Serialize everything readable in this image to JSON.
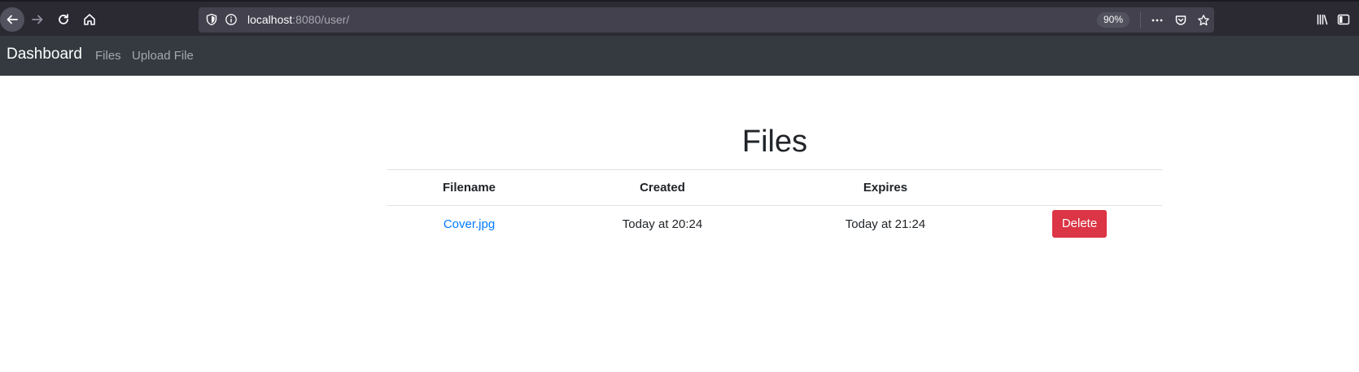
{
  "browser": {
    "url_host": "localhost",
    "url_rest": ":8080/user/",
    "zoom": "90%"
  },
  "navbar": {
    "brand": "Dashboard",
    "links": [
      {
        "label": "Files"
      },
      {
        "label": "Upload File"
      }
    ],
    "background_color": "#343a40"
  },
  "main": {
    "title": "Files",
    "table": {
      "headers": [
        "Filename",
        "Created",
        "Expires",
        ""
      ],
      "rows": [
        {
          "filename": "Cover.jpg",
          "created": "Today at 20:24",
          "expires": "Today at 21:24",
          "action_label": "Delete"
        }
      ]
    }
  },
  "colors": {
    "link": "#007bff",
    "danger": "#dc3545",
    "browser_chrome": "#2b2a33"
  },
  "icons": {
    "back": "back-arrow-icon",
    "forward": "forward-arrow-icon",
    "reload": "reload-icon",
    "home": "home-icon",
    "tracking": "shield-icon",
    "site_info": "info-icon",
    "page_actions": "more-icon",
    "pocket": "pocket-icon",
    "bookmark": "star-icon",
    "library": "library-icon",
    "sidebar": "sidebar-icon"
  }
}
